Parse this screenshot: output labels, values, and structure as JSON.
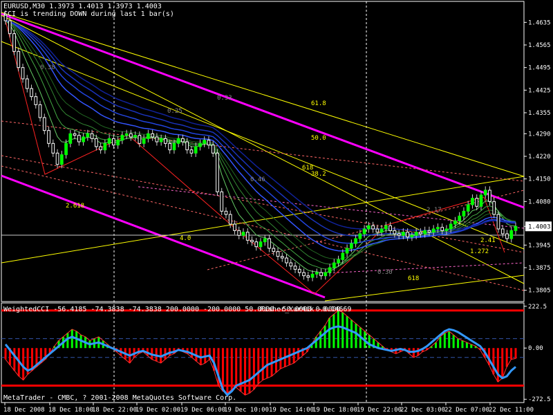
{
  "header": {
    "symbol_line": "EURUSD,M30  1.3973 1.4013 1.3973 1.4003",
    "alert_line": "CCI is trending DOWN during last 1 bar(s)"
  },
  "indicator_header": {
    "left": "WeightedCCI -56.4185 -74.3838 -74.3838 200.0000 -200.0000 50.0000 -50.0000 0.0000",
    "right": "Fisher_Yur4ik -0.14669"
  },
  "copyright": "MetaTrader - CMBC, ? 2001-2008 MetaQuotes Software Corp.",
  "colors": {
    "background": "#000000",
    "bull_candle": "#00ff00",
    "bear_candle": "#ffffff",
    "magenta_channel": "#ff00ff",
    "yellow_lines": "#ffff00",
    "cci_positive": "#00ff00",
    "cci_negative": "#ff0000",
    "fisher_line": "#3399ff",
    "level_line": "#ff0000"
  },
  "chart_data": [
    {
      "type": "candlestick",
      "title": "EURUSD,M30",
      "ylim": [
        1.377,
        1.47
      ],
      "y_ticks": [
        "1.4635",
        "1.4565",
        "1.4495",
        "1.4425",
        "1.4355",
        "1.4290",
        "1.4220",
        "1.4150",
        "1.4080",
        "1.4003",
        "1.3945",
        "1.3875",
        "1.3805"
      ],
      "current_price": "1.4003",
      "x_ticks": [
        "18 Dec 2008",
        "18 Dec 18:00",
        "18 Dec 22:00",
        "19 Dec 02:00",
        "19 Dec 06:00",
        "19 Dec 10:00",
        "19 Dec 14:00",
        "19 Dec 18:00",
        "19 Dec 22:00",
        "22 Dec 03:00",
        "22 Dec 07:00",
        "22 Dec 11:00"
      ],
      "closes": [
        1.464,
        1.46,
        1.4545,
        1.4495,
        1.446,
        1.443,
        1.4405,
        1.438,
        1.434,
        1.43,
        1.426,
        1.423,
        1.4195,
        1.4225,
        1.426,
        1.429,
        1.4285,
        1.4265,
        1.428,
        1.429,
        1.4275,
        1.425,
        1.424,
        1.426,
        1.4275,
        1.4255,
        1.427,
        1.4285,
        1.429,
        1.428,
        1.4285,
        1.426,
        1.4275,
        1.429,
        1.428,
        1.4265,
        1.4275,
        1.426,
        1.424,
        1.426,
        1.4275,
        1.4265,
        1.424,
        1.423,
        1.425,
        1.426,
        1.427,
        1.4255,
        1.423,
        1.411,
        1.405,
        1.404,
        1.401,
        1.399,
        1.3975,
        1.3985,
        1.396,
        1.3955,
        1.394,
        1.3955,
        1.3965,
        1.3935,
        1.3925,
        1.391,
        1.3905,
        1.389,
        1.388,
        1.387,
        1.386,
        1.385,
        1.3845,
        1.3855,
        1.386,
        1.385,
        1.386,
        1.3875,
        1.389,
        1.39,
        1.392,
        1.3935,
        1.395,
        1.3965,
        1.398,
        1.3995,
        1.4005,
        1.3995,
        1.3985,
        1.3995,
        1.4005,
        1.399,
        1.398,
        1.3975,
        1.3985,
        1.397,
        1.3975,
        1.3985,
        1.398,
        1.399,
        1.3985,
        1.3995,
        1.4,
        1.399,
        1.3995,
        1.401,
        1.402,
        1.4035,
        1.405,
        1.407,
        1.409,
        1.4065,
        1.41,
        1.4115,
        1.408,
        1.404,
        1.3995,
        1.398,
        1.3965,
        1.399,
        1.4003
      ],
      "annotations": [
        "0.38",
        "0.25",
        "0.33",
        "61.8",
        "50.0",
        "618",
        "38.2",
        "0.46",
        "2.618",
        "4.0",
        "2.17",
        "2.41",
        "1.272",
        "0.30",
        "618"
      ]
    },
    {
      "type": "bar",
      "title": "WeightedCCI / Fisher_Yur4ik",
      "ylim": [
        -290,
        240
      ],
      "y_ticks": [
        "222.5",
        "0.00",
        "-272.5"
      ],
      "levels": [
        200,
        50,
        -50,
        -200
      ],
      "cci": [
        -60,
        -90,
        -120,
        -150,
        -170,
        -140,
        -120,
        -100,
        -80,
        -60,
        -30,
        10,
        40,
        60,
        80,
        100,
        90,
        70,
        60,
        40,
        50,
        60,
        40,
        20,
        0,
        -20,
        -40,
        -60,
        -80,
        -50,
        -30,
        -20,
        -40,
        -60,
        -70,
        -80,
        -60,
        -40,
        -30,
        -10,
        -20,
        -30,
        -50,
        -70,
        -90,
        -80,
        -60,
        -120,
        -200,
        -230,
        -240,
        -220,
        -210,
        -230,
        -250,
        -240,
        -220,
        -190,
        -170,
        -160,
        -150,
        -130,
        -110,
        -100,
        -90,
        -80,
        -60,
        -40,
        -20,
        20,
        60,
        90,
        120,
        160,
        180,
        200,
        190,
        170,
        150,
        130,
        110,
        90,
        70,
        50,
        30,
        10,
        -10,
        -20,
        -30,
        -20,
        -10,
        -30,
        -50,
        -40,
        -20,
        -10,
        10,
        30,
        60,
        80,
        90,
        70,
        50,
        40,
        30,
        20,
        10,
        -10,
        -50,
        -90,
        -140,
        -180,
        -160,
        -100,
        -60,
        -56
      ],
      "fisher": [
        20,
        -10,
        -40,
        -70,
        -100,
        -120,
        -110,
        -90,
        -70,
        -50,
        -30,
        -10,
        10,
        30,
        50,
        60,
        50,
        40,
        30,
        20,
        25,
        30,
        20,
        10,
        0,
        -10,
        -20,
        -30,
        -40,
        -30,
        -20,
        -15,
        -25,
        -35,
        -40,
        -45,
        -35,
        -25,
        -20,
        -10,
        -15,
        -20,
        -30,
        -40,
        -50,
        -45,
        -40,
        -80,
        -150,
        -220,
        -250,
        -230,
        -200,
        -190,
        -180,
        -170,
        -150,
        -130,
        -110,
        -90,
        -80,
        -70,
        -60,
        -50,
        -40,
        -30,
        -20,
        -10,
        0,
        20,
        40,
        60,
        80,
        100,
        110,
        115,
        110,
        100,
        90,
        80,
        60,
        40,
        20,
        10,
        0,
        -5,
        -10,
        -15,
        -10,
        -5,
        -10,
        -20,
        -20,
        -15,
        -5,
        10,
        30,
        50,
        70,
        90,
        100,
        95,
        85,
        70,
        55,
        40,
        25,
        10,
        -20,
        -60,
        -100,
        -140,
        -160,
        -150,
        -120,
        -100
      ]
    }
  ]
}
